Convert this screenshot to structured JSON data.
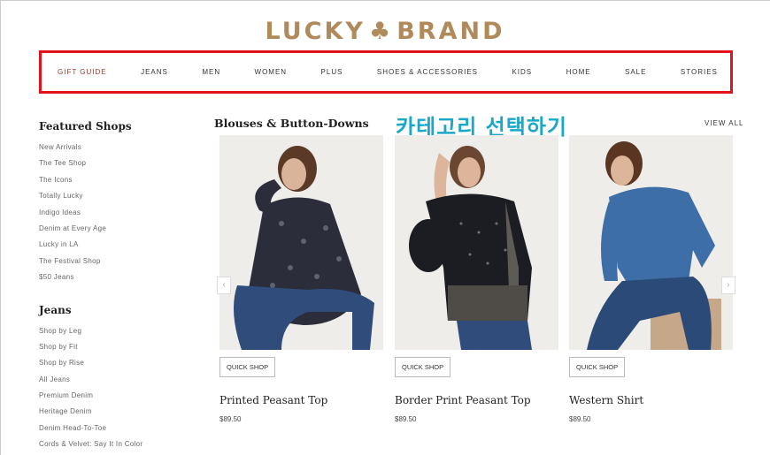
{
  "brand": {
    "logo_left": "LUCKY",
    "logo_clover": "♣",
    "logo_right": "BRAND",
    "color": "#b08a5a"
  },
  "nav": {
    "items": [
      {
        "label": "GIFT GUIDE"
      },
      {
        "label": "JEANS"
      },
      {
        "label": "MEN"
      },
      {
        "label": "WOMEN"
      },
      {
        "label": "PLUS"
      },
      {
        "label": "SHOES & ACCESSORIES"
      },
      {
        "label": "KIDS"
      },
      {
        "label": "HOME"
      },
      {
        "label": "SALE"
      },
      {
        "label": "STORIES"
      }
    ],
    "highlight_color": "#e3131b"
  },
  "sidebar": {
    "featured": {
      "heading": "Featured Shops",
      "links": [
        "New Arrivals",
        "The Tee Shop",
        "The Icons",
        "Totally Lucky",
        "Indigo Ideas",
        "Denim at Every Age",
        "Lucky in LA",
        "The Festival Shop",
        "$50 Jeans"
      ]
    },
    "jeans": {
      "heading": "Jeans",
      "links": [
        "Shop by Leg",
        "Shop by Fit",
        "Shop by Rise",
        "All Jeans",
        "Premium Denim",
        "Heritage Denim",
        "Denim Head-To-Toe",
        "Cords & Velvet: Say It In Color"
      ]
    }
  },
  "section": {
    "title": "Blouses & Button-Downs",
    "view_all": "VIEW ALL"
  },
  "overlay_caption": "카테고리 선택하기",
  "products": [
    {
      "name": "Printed Peasant Top",
      "price": "$89.50",
      "quick_shop": "QUICK SHOP"
    },
    {
      "name": "Border Print Peasant Top",
      "price": "$89.50",
      "quick_shop": "QUICK SHOP"
    },
    {
      "name": "Western Shirt",
      "price": "$89.50",
      "quick_shop": "QUICK SHOP"
    }
  ],
  "carousel": {
    "prev_icon": "chevron-left-icon",
    "next_icon": "chevron-right-icon"
  }
}
